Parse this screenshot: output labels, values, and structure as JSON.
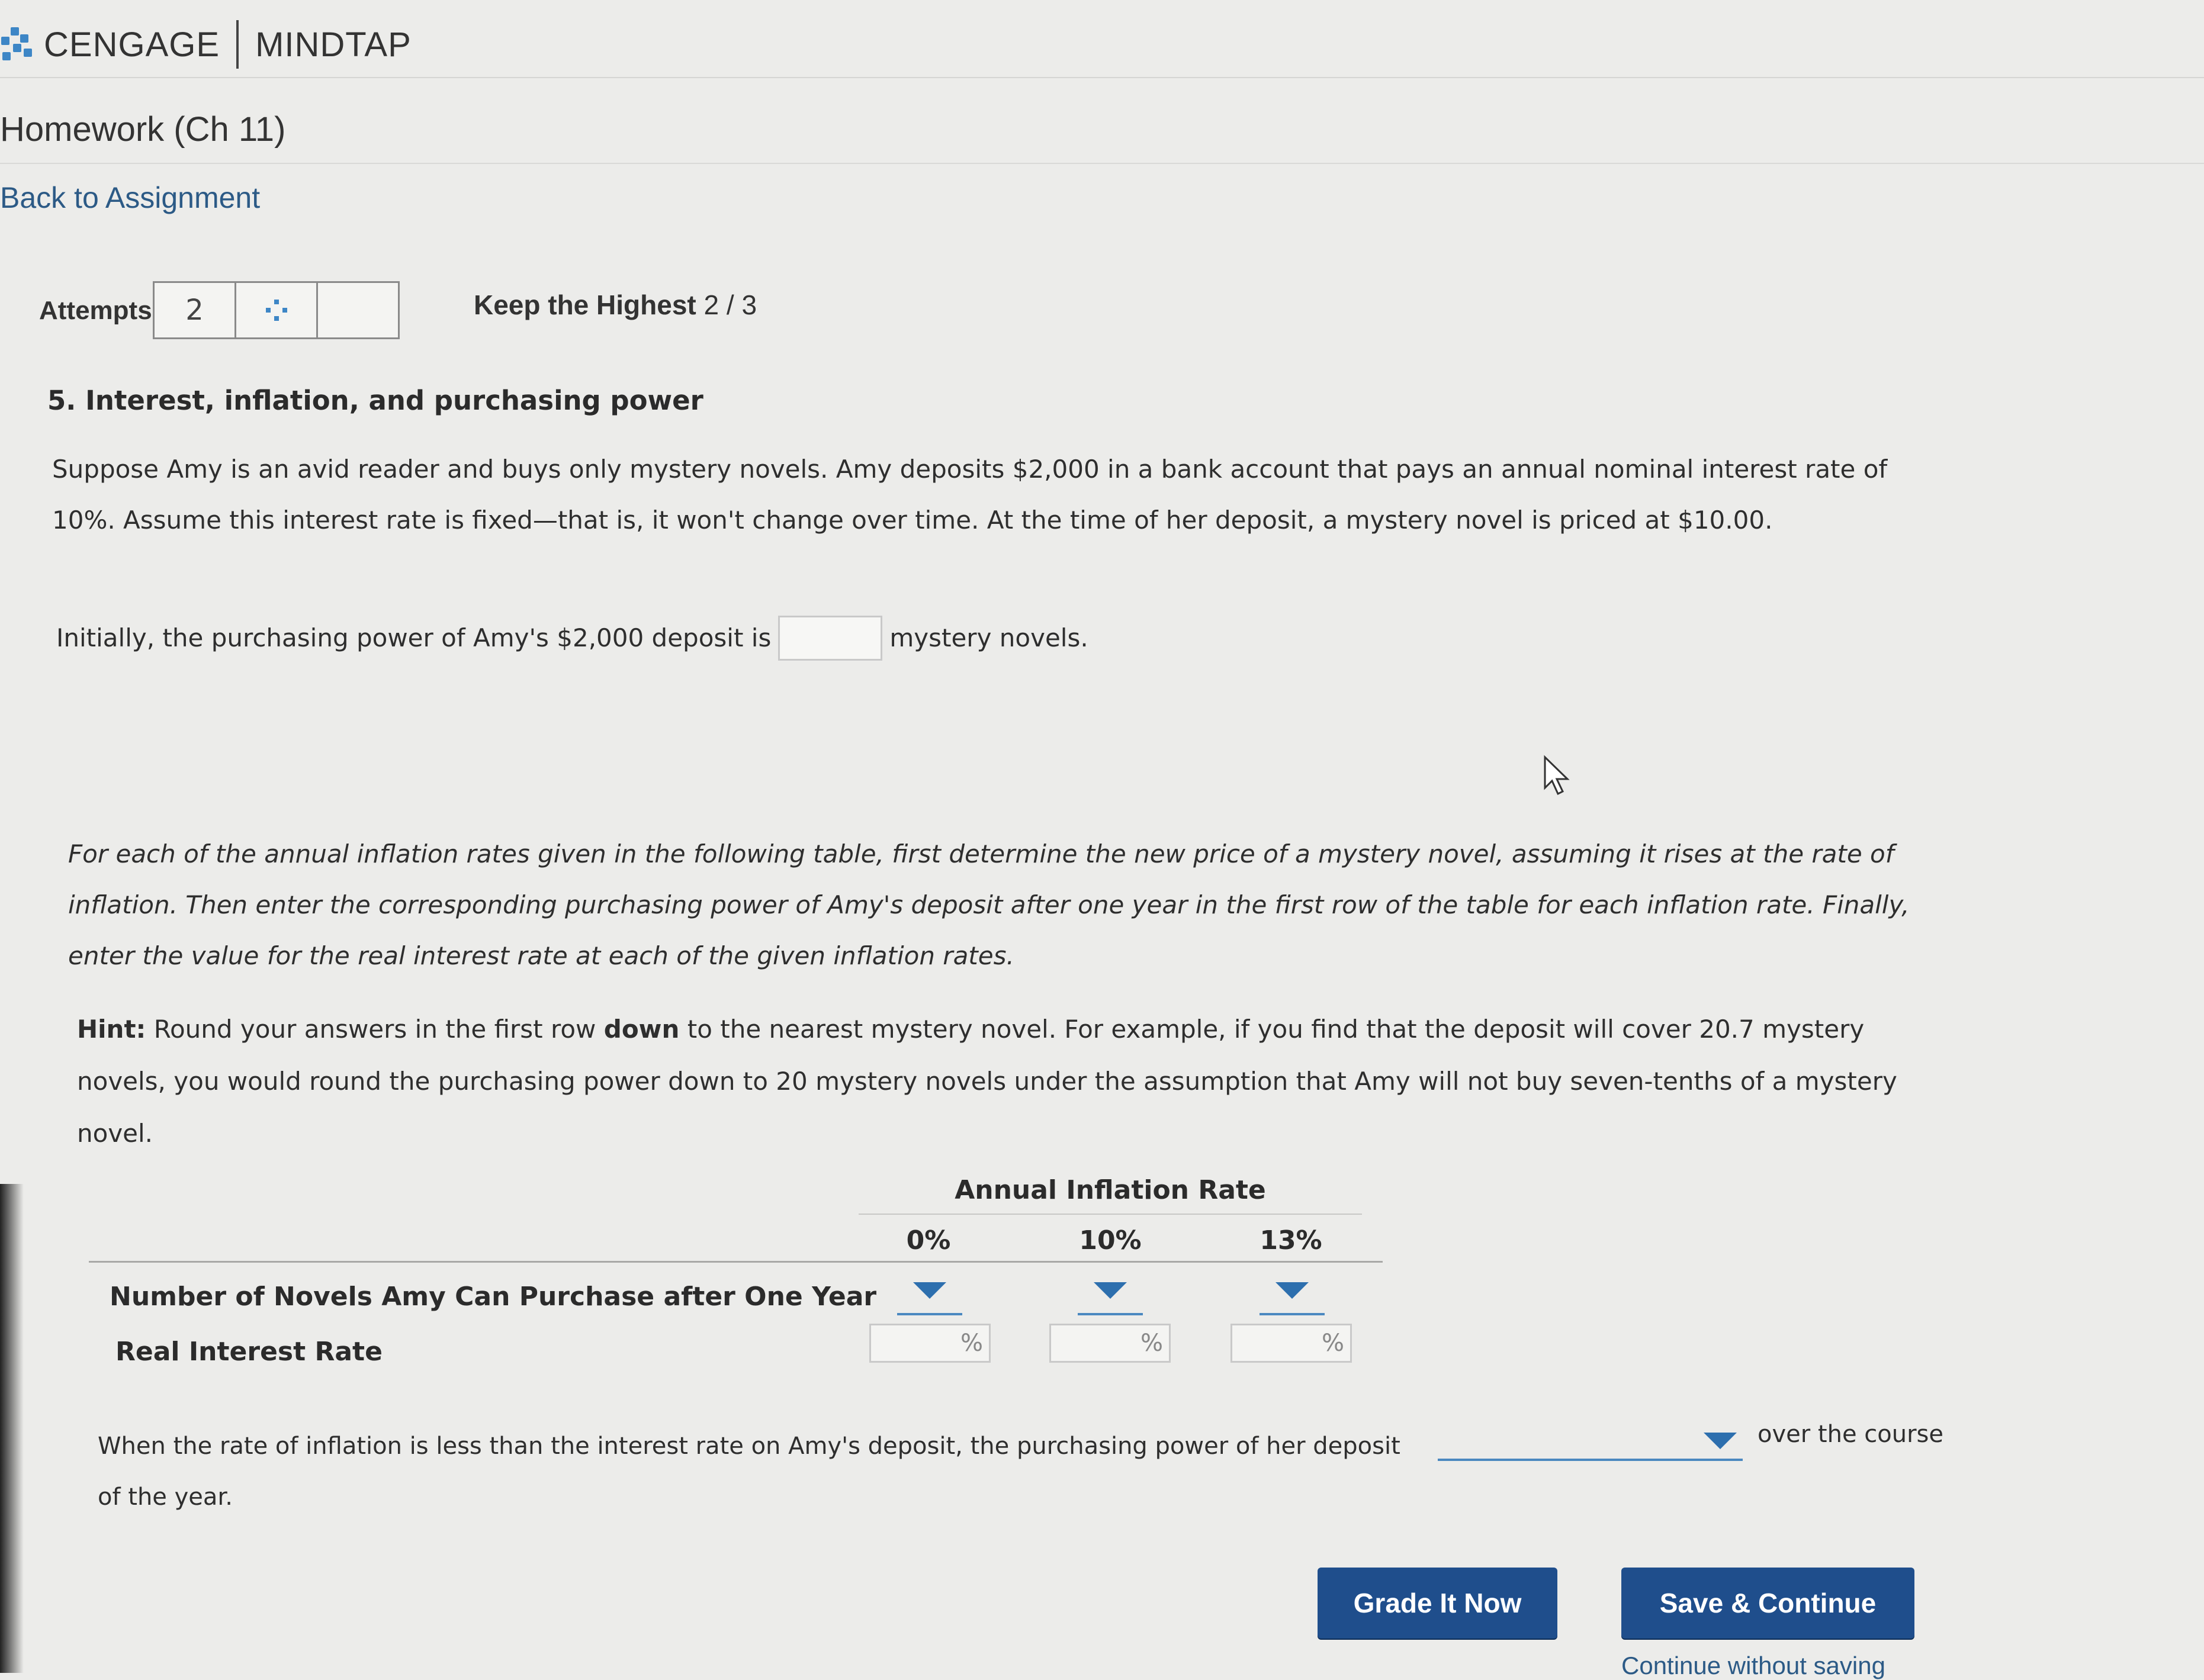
{
  "header": {
    "brand": "CENGAGE",
    "product": "MINDTAP",
    "course": "Homework (Ch 11)",
    "back_link": "Back to Assignment"
  },
  "attempts": {
    "label": "Attempts",
    "value": "2",
    "keep_label": "Keep the Highest",
    "keep_value": "2 / 3"
  },
  "question": {
    "title": "5. Interest, inflation, and purchasing power",
    "intro_line1": "Suppose Amy is an avid reader and buys only mystery novels. Amy deposits $2,000 in a bank account that pays an annual nominal interest rate of",
    "intro_line2": "10%. Assume this interest rate is fixed—that is, it won't change over time. At the time of her deposit, a mystery novel is priced at $10.00.",
    "pp_before": "Initially, the purchasing power of Amy's $2,000 deposit is",
    "pp_after": "mystery novels.",
    "instructions_line1": "For each of the annual inflation rates given in the following table, first determine the new price of a mystery novel, assuming it rises at the rate of",
    "instructions_line2": "inflation. Then enter the corresponding purchasing power of Amy's deposit after one year in the first row of the table for each inflation rate. Finally,",
    "instructions_line3": "enter the value for the real interest rate at each of the given inflation rates.",
    "hint_label": "Hint:",
    "hint_part1": "Round your answers in the first row",
    "hint_bold": "down",
    "hint_part2": "to the nearest mystery novel. For example, if you find that the deposit will cover 20.7 mystery",
    "hint_line2": "novels, you would round the purchasing power down to 20 mystery novels under the assumption that Amy will not buy seven-tenths of a mystery",
    "hint_line3": "novel."
  },
  "table": {
    "header": "Annual Inflation Rate",
    "columns": [
      "0%",
      "10%",
      "13%"
    ],
    "row1_label": "Number of Novels Amy Can Purchase after One Year",
    "row2_label": "Real Interest Rate",
    "pct_symbol": "%"
  },
  "conclusion": {
    "before": "When the rate of inflation is less than the interest rate on Amy's deposit, the purchasing power of her deposit",
    "after": "over the course",
    "line2": "of the year."
  },
  "buttons": {
    "grade": "Grade It Now",
    "save": "Save & Continue",
    "continue_without": "Continue without saving"
  },
  "colors": {
    "accent": "#1f4e8c",
    "link": "#2c5a86",
    "dropdown": "#2d6fae"
  }
}
